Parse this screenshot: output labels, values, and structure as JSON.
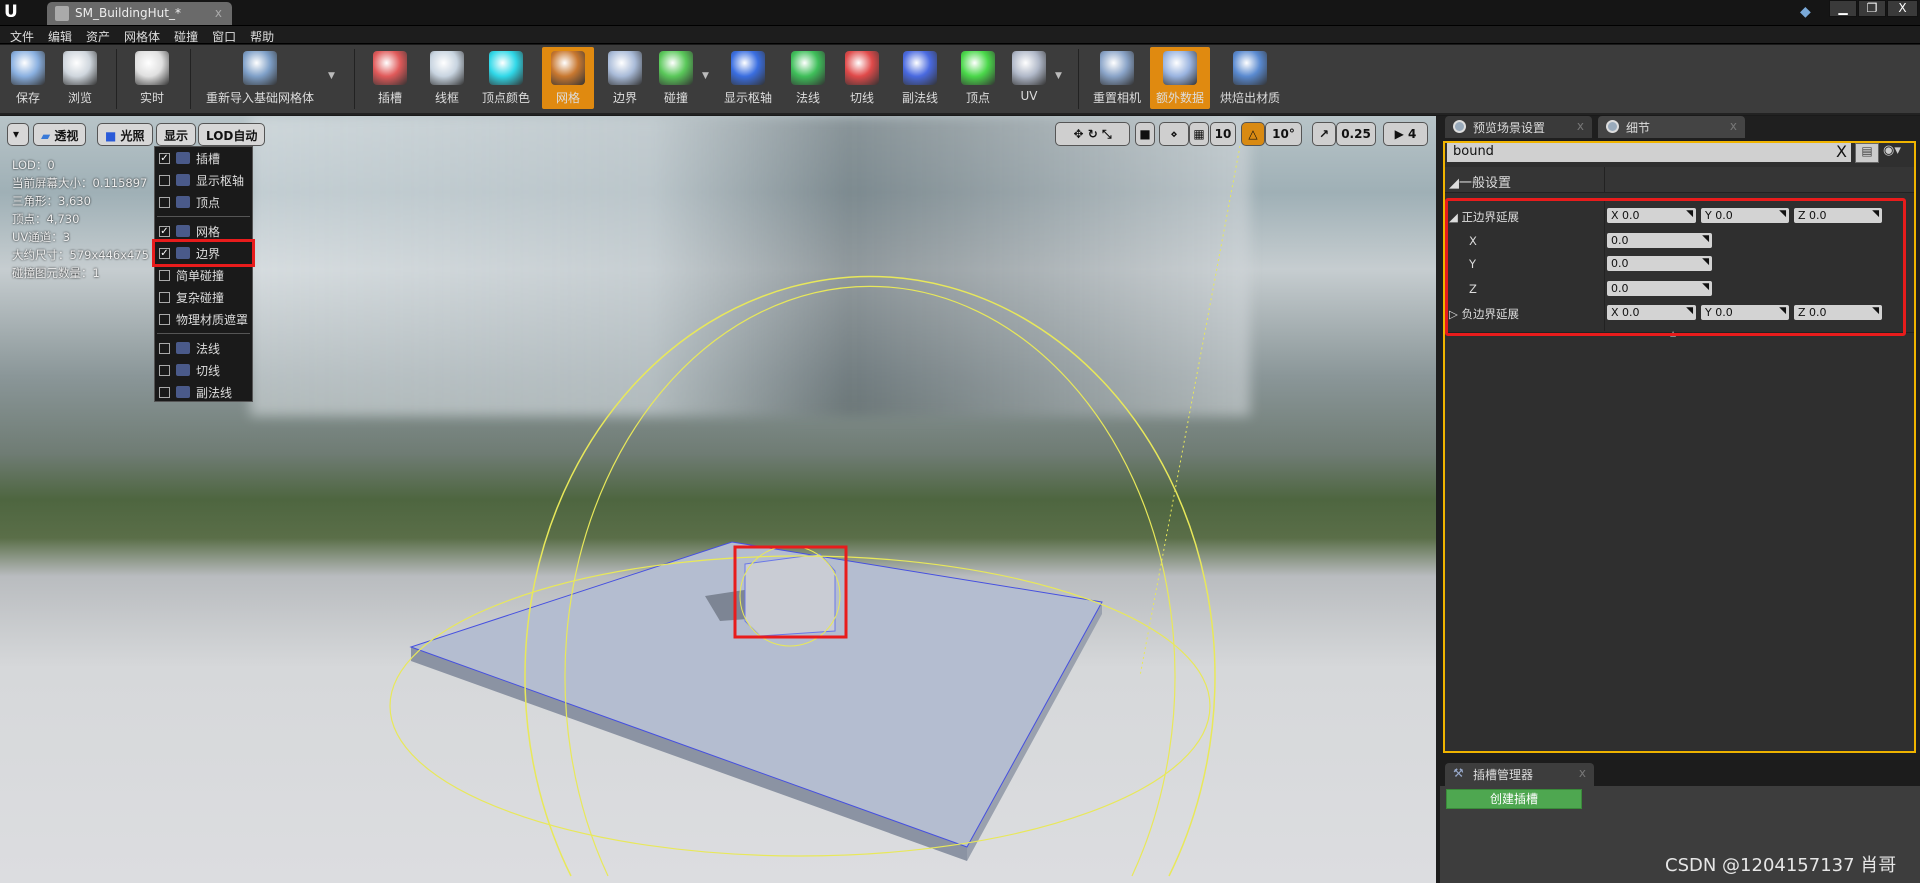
{
  "window": {
    "tab_title": "SM_BuildingHut_*",
    "tab_close": "x",
    "min": "▁",
    "restore": "❐",
    "close": "X"
  },
  "menu": [
    "文件",
    "编辑",
    "资产",
    "网格体",
    "碰撞",
    "窗口",
    "帮助"
  ],
  "toolbar": [
    {
      "label": "保存",
      "icon": "save-icon",
      "color": "#8ab0e0"
    },
    {
      "label": "浏览",
      "icon": "browse-magnifier-icon",
      "color": "#cfd6dd"
    },
    {
      "label": "实时",
      "icon": "stopwatch-icon",
      "color": "#e0e0e0"
    },
    {
      "label": "重新导入基础网格体",
      "icon": "reimport-icon",
      "color": "#7fa0c8",
      "dropdown": true
    },
    {
      "label": "插槽",
      "icon": "socket-icon",
      "color": "#e05a5a"
    },
    {
      "label": "线框",
      "icon": "wireframe-icon",
      "color": "#c8d4e0"
    },
    {
      "label": "顶点颜色",
      "icon": "vertex-color-icon",
      "color": "#30d8e8"
    },
    {
      "label": "网格",
      "icon": "grid-icon",
      "color": "#c87830",
      "active": true
    },
    {
      "label": "边界",
      "icon": "bounds-icon",
      "color": "#a9bbd8"
    },
    {
      "label": "碰撞",
      "icon": "collision-icon",
      "color": "#5ac85a",
      "dropdown": true
    },
    {
      "label": "显示枢轴",
      "icon": "pivot-icon",
      "color": "#3a6ee0"
    },
    {
      "label": "法线",
      "icon": "normals-icon",
      "color": "#3fbf5a"
    },
    {
      "label": "切线",
      "icon": "tangents-icon",
      "color": "#e04a4a"
    },
    {
      "label": "副法线",
      "icon": "binormals-icon",
      "color": "#4a6ae0"
    },
    {
      "label": "顶点",
      "icon": "vertices-icon",
      "color": "#4ad84a"
    },
    {
      "label": "UV",
      "icon": "uv-icon",
      "color": "#b0b8c8",
      "dropdown": true
    },
    {
      "label": "重置相机",
      "icon": "reset-camera-icon",
      "color": "#8aa4c8"
    },
    {
      "label": "额外数据",
      "icon": "additional-data-icon",
      "color": "#9ab4e0",
      "active": true
    },
    {
      "label": "烘焙出材质",
      "icon": "bake-material-icon",
      "color": "#5a8ad0"
    }
  ],
  "viewport": {
    "menu_btn": "▾",
    "perspective": "透视",
    "lit": "光照",
    "show": "显示",
    "lod": "LOD自动",
    "stats": [
      "LOD：0",
      "当前屏幕大小：0.115897",
      "三角形：3,630",
      "顶点：4,730",
      "UV通道：3",
      "大约尺寸：579x446x475",
      "碰撞图元数量：1"
    ],
    "show_menu": [
      {
        "label": "插槽",
        "checked": true,
        "icon": "socket-icon"
      },
      {
        "label": "显示枢轴",
        "checked": false,
        "icon": "pivot-icon"
      },
      {
        "label": "顶点",
        "checked": false,
        "icon": "vertices-icon"
      },
      {
        "sep": true
      },
      {
        "label": "网格",
        "checked": true,
        "icon": "grid-icon"
      },
      {
        "label": "边界",
        "checked": true,
        "icon": "bounds-icon",
        "highlighted": true
      },
      {
        "label": "简单碰撞",
        "checked": false
      },
      {
        "label": "复杂碰撞",
        "checked": false
      },
      {
        "label": "物理材质遮罩",
        "checked": false
      },
      {
        "sep": true
      },
      {
        "label": "法线",
        "checked": false,
        "icon": "normals-icon"
      },
      {
        "label": "切线",
        "checked": false,
        "icon": "tangents-icon"
      },
      {
        "label": "副法线",
        "checked": false,
        "icon": "binormals-icon"
      }
    ],
    "grid_snap": "10",
    "rot_snap": "10°",
    "scale_snap": "0.25",
    "cam_speed": "4"
  },
  "panel": {
    "tabs": [
      "预览场景设置",
      "细节"
    ],
    "search_value": "bound",
    "search_clear": "X",
    "category": "一般设置",
    "pos_label": "正边界延展",
    "neg_label": "负边界延展",
    "pos": {
      "x": "0.0",
      "y": "0.0",
      "z": "0.0"
    },
    "neg": {
      "x": "0.0",
      "y": "0.0",
      "z": "0.0"
    },
    "axes": [
      "X",
      "Y",
      "Z"
    ]
  },
  "socket_manager": {
    "tab": "插槽管理器",
    "create": "创建插槽"
  },
  "watermark": "CSDN @1204157137 肖哥",
  "colors": {
    "accent": "#e08a10",
    "highlight": "#e81c1c",
    "search_border": "#f0b400",
    "create_button": "#4ea750"
  }
}
